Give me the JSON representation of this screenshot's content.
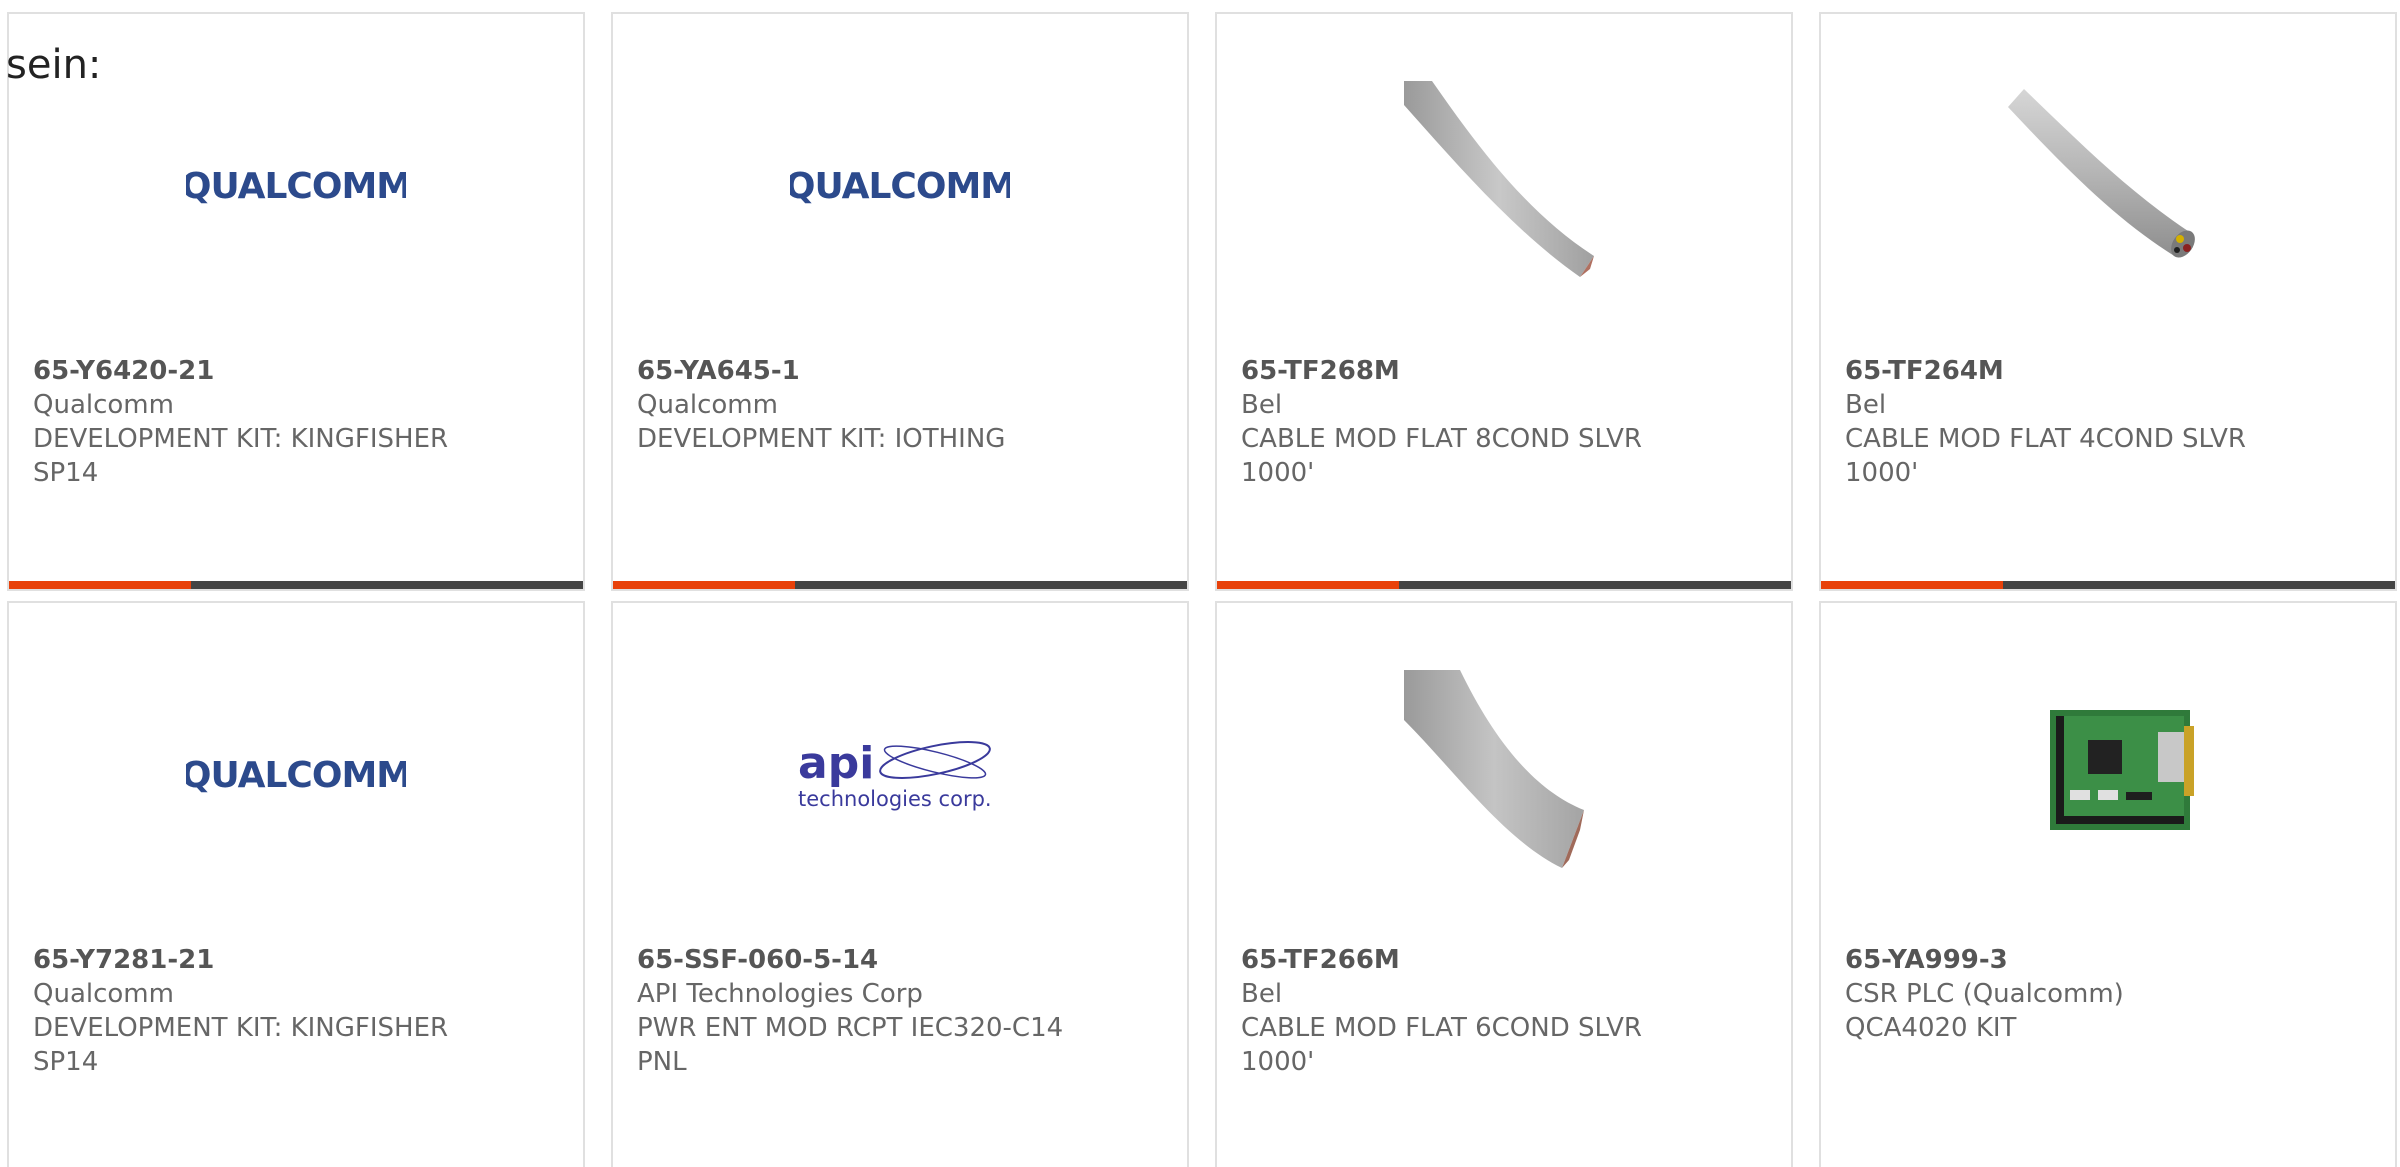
{
  "intro_text": "sein:",
  "colors": {
    "accent_bar": "#e8410a",
    "dark_bar": "#444444",
    "qualcomm_blue": "#2c4a8c",
    "api_blue": "#3a3a9c",
    "text_gray": "#666666"
  },
  "products": [
    {
      "part": "65-Y6420-21",
      "maker": "Qualcomm",
      "desc": "DEVELOPMENT KIT: KINGFISHER SP14",
      "image": "qualcomm-logo"
    },
    {
      "part": "65-YA645-1",
      "maker": "Qualcomm",
      "desc": "DEVELOPMENT KIT: IOTHING",
      "image": "qualcomm-logo"
    },
    {
      "part": "65-TF268M",
      "maker": "Bel",
      "desc": "CABLE MOD FLAT 8COND SLVR 1000'",
      "image": "flat-cable-photo"
    },
    {
      "part": "65-TF264M",
      "maker": "Bel",
      "desc": "CABLE MOD FLAT 4COND SLVR 1000'",
      "image": "round-cable-photo"
    },
    {
      "part": "65-Y7281-21",
      "maker": "Qualcomm",
      "desc": "DEVELOPMENT KIT: KINGFISHER SP14",
      "image": "qualcomm-logo"
    },
    {
      "part": "65-SSF-060-5-14",
      "maker": "API Technologies Corp",
      "desc": "PWR ENT MOD RCPT IEC320-C14 PNL",
      "image": "api-logo"
    },
    {
      "part": "65-TF266M",
      "maker": "Bel",
      "desc": "CABLE MOD FLAT 6COND SLVR 1000'",
      "image": "flat-cable-photo"
    },
    {
      "part": "65-YA999-3",
      "maker": "CSR PLC (Qualcomm)",
      "desc": "QCA4020 KIT",
      "image": "pcb-board-photo"
    }
  ],
  "logos": {
    "qualcomm": "QUALCOMM",
    "api_main": "api",
    "api_sub": "technologies corp."
  }
}
